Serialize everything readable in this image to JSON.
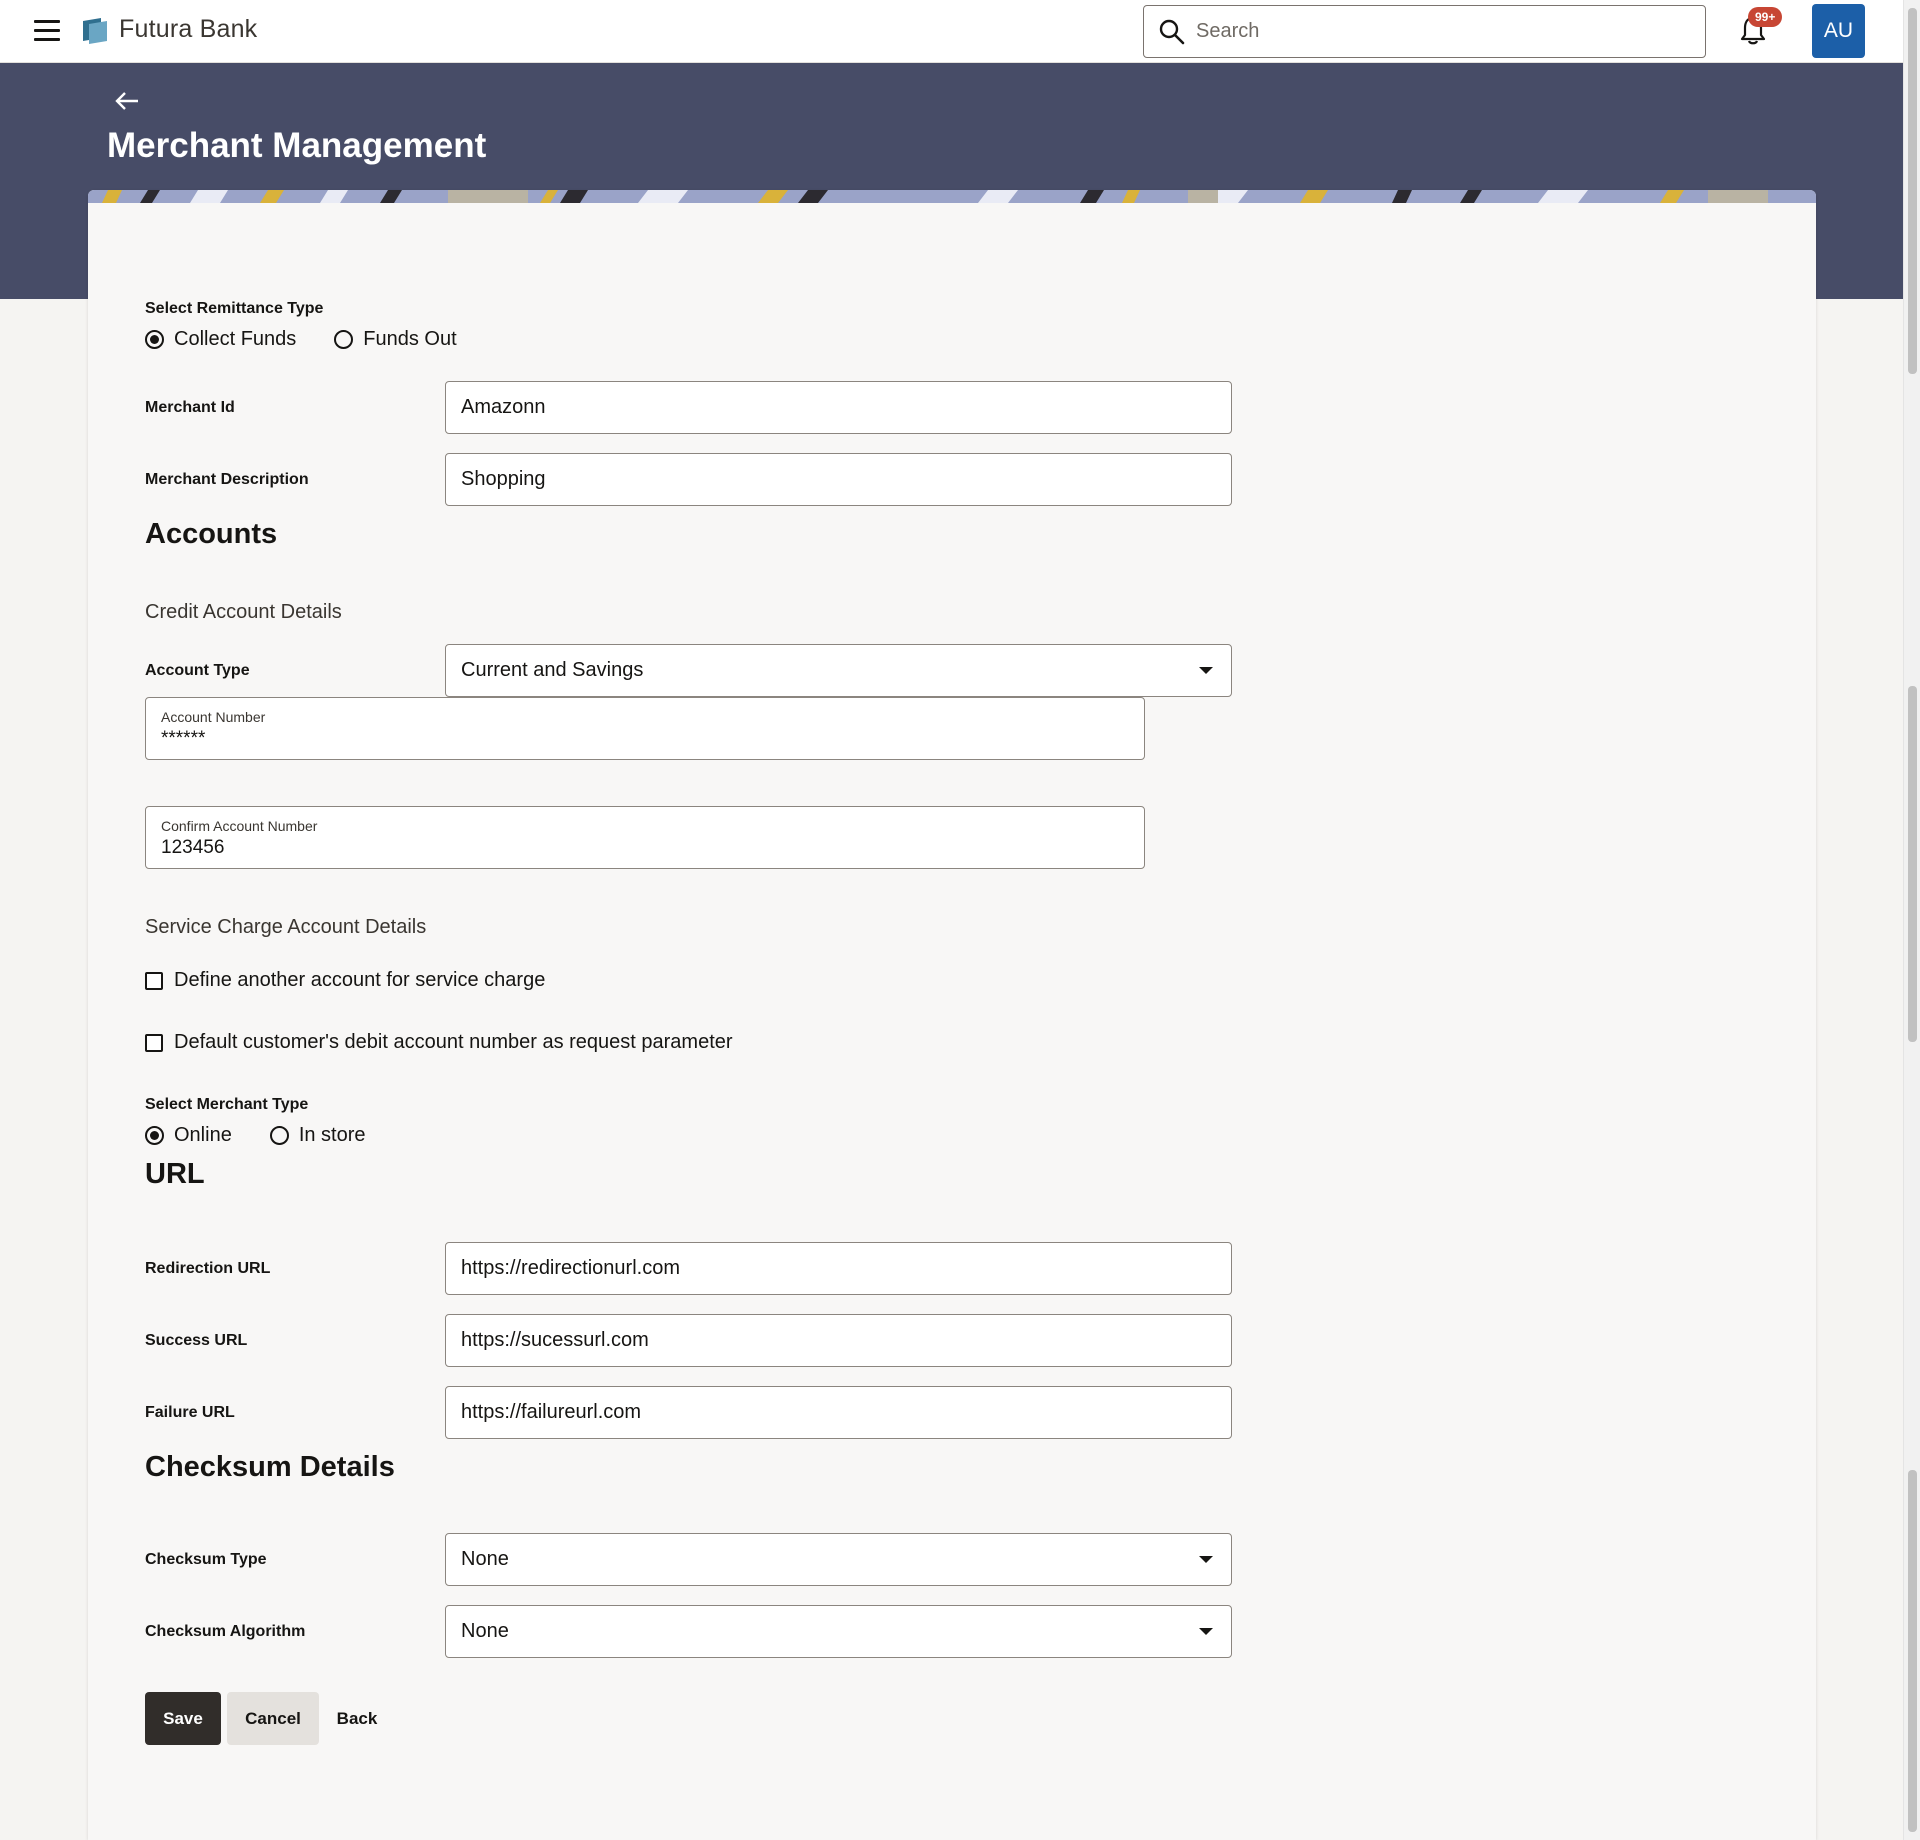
{
  "topbar": {
    "brand": "Futura Bank",
    "search_placeholder": "Search",
    "notification_count": "99+",
    "avatar_initials": "AU"
  },
  "header": {
    "title": "Merchant Management"
  },
  "remittance": {
    "label": "Select Remittance Type",
    "options": [
      "Collect Funds",
      "Funds Out"
    ],
    "selected": "Collect Funds"
  },
  "merchant": {
    "id_label": "Merchant Id",
    "id_value": "Amazonn",
    "desc_label": "Merchant Description",
    "desc_value": "Shopping"
  },
  "accounts": {
    "heading": "Accounts",
    "credit_heading": "Credit Account Details",
    "account_type_label": "Account Type",
    "account_type_value": "Current and Savings",
    "account_number_label": "Account Number",
    "account_number_value": "******",
    "confirm_label": "Confirm Account Number",
    "confirm_value": "123456",
    "service_heading": "Service Charge Account Details",
    "checkbox_service": "Define another account for service charge",
    "checkbox_default": "Default customer's debit account number as request parameter"
  },
  "merchant_type": {
    "label": "Select Merchant Type",
    "options": [
      "Online",
      "In store"
    ],
    "selected": "Online"
  },
  "url": {
    "heading": "URL",
    "redirection_label": "Redirection URL",
    "redirection_value": "https://redirectionurl.com",
    "success_label": "Success URL",
    "success_value": "https://sucessurl.com",
    "failure_label": "Failure URL",
    "failure_value": "https://failureurl.com"
  },
  "checksum": {
    "heading": "Checksum Details",
    "type_label": "Checksum Type",
    "type_value": "None",
    "algorithm_label": "Checksum Algorithm",
    "algorithm_value": "None"
  },
  "actions": {
    "save": "Save",
    "cancel": "Cancel",
    "back": "Back"
  },
  "colors": {
    "header_band": "#474c67",
    "primary_button": "#312d2a",
    "avatar": "#1c5fa8",
    "badge": "#c74634"
  }
}
